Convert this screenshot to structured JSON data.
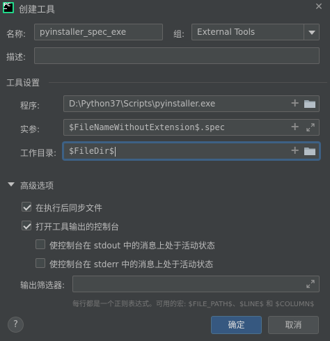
{
  "window": {
    "title": "创建工具",
    "app_icon_text": "PC"
  },
  "form": {
    "name_label": "名称:",
    "name_value": "pyinstaller_spec_exe",
    "group_label": "组:",
    "group_value": "External Tools",
    "description_label": "描述:",
    "description_value": ""
  },
  "tool_settings": {
    "section_title": "工具设置",
    "program_label": "程序:",
    "program_value": "D:\\Python37\\Scripts\\pyinstaller.exe",
    "arguments_label": "实参:",
    "arguments_value": "$FileNameWithoutExtension$.spec",
    "working_dir_label": "工作目录:",
    "working_dir_value": "$FileDir$"
  },
  "advanced": {
    "section_title": "高级选项",
    "options": [
      {
        "label": "在执行后同步文件",
        "checked": true
      },
      {
        "label": "打开工具输出的控制台",
        "checked": true
      },
      {
        "label": "使控制台在 stdout 中的消息上处于活动状态",
        "checked": false
      },
      {
        "label": "使控制台在 stderr 中的消息上处于活动状态",
        "checked": false
      }
    ],
    "output_filters_label": "输出筛选器:",
    "output_filters_value": "",
    "hint": "每行都是一个正则表达式。可用的宏: $FILE_PATH$、$LINE$ 和 $COLUMN$"
  },
  "buttons": {
    "help": "?",
    "ok": "确定",
    "cancel": "取消"
  },
  "icons": {
    "close": "close-icon",
    "dropdown": "chevron-down-icon",
    "add": "plus-icon",
    "folder": "folder-icon",
    "expand": "expand-icon",
    "collapse": "triangle-down-icon"
  },
  "colors": {
    "background": "#3c3f41",
    "field": "#45494a",
    "accent": "#365880",
    "focus": "#3d6185"
  }
}
